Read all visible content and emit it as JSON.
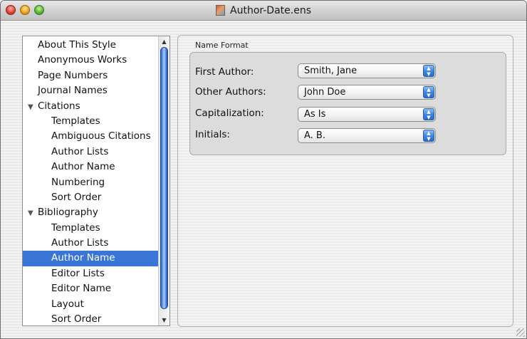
{
  "window": {
    "title": "Author-Date.ens",
    "icons": {
      "close": "close-icon",
      "minimize": "minimize-icon",
      "zoom": "zoom-icon",
      "document": "document-icon"
    }
  },
  "sidebar": {
    "items": [
      {
        "label": "About This Style",
        "level": 0
      },
      {
        "label": "Anonymous Works",
        "level": 0
      },
      {
        "label": "Page Numbers",
        "level": 0
      },
      {
        "label": "Journal Names",
        "level": 0
      },
      {
        "label": "Citations",
        "level": 0,
        "expanded": true
      },
      {
        "label": "Templates",
        "level": 1
      },
      {
        "label": "Ambiguous Citations",
        "level": 1
      },
      {
        "label": "Author Lists",
        "level": 1
      },
      {
        "label": "Author Name",
        "level": 1
      },
      {
        "label": "Numbering",
        "level": 1
      },
      {
        "label": "Sort Order",
        "level": 1
      },
      {
        "label": "Bibliography",
        "level": 0,
        "expanded": true
      },
      {
        "label": "Templates",
        "level": 1
      },
      {
        "label": "Author Lists",
        "level": 1
      },
      {
        "label": "Author Name",
        "level": 1,
        "selected": true
      },
      {
        "label": "Editor Lists",
        "level": 1
      },
      {
        "label": "Editor Name",
        "level": 1
      },
      {
        "label": "Layout",
        "level": 1
      },
      {
        "label": "Sort Order",
        "level": 1
      }
    ]
  },
  "panel": {
    "group_title": "Name Format",
    "fields": [
      {
        "label": "First Author:",
        "value": "Smith, Jane"
      },
      {
        "label": "Other Authors:",
        "value": "John Doe"
      },
      {
        "label": "Capitalization:",
        "value": "As Is"
      },
      {
        "label": "Initials:",
        "value": "A. B."
      }
    ]
  },
  "colors": {
    "selection": "#3875d7",
    "scroll_thumb": "#4a86e0"
  }
}
